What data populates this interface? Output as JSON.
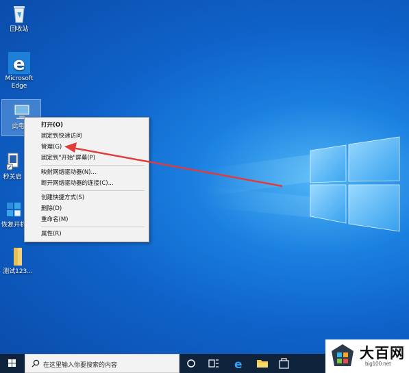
{
  "desktop": {
    "icons": [
      {
        "label": "回收站",
        "icon": "recycle-bin-icon"
      },
      {
        "label": "Microsoft Edge",
        "icon": "edge-icon"
      },
      {
        "label": "此电脑",
        "icon": "this-pc-icon"
      },
      {
        "label": "秒关启",
        "icon": "shortcut-icon"
      },
      {
        "label": "恢复开机",
        "icon": "restore-icon"
      },
      {
        "label": "测试123...",
        "icon": "folder-icon"
      }
    ]
  },
  "context_menu": {
    "items": [
      {
        "label": "打开(O)",
        "bold": true
      },
      {
        "label": "固定到快速访问"
      },
      {
        "label": "管理(G)"
      },
      {
        "label": "固定到\"开始\"屏幕(P)"
      },
      {
        "separator": true
      },
      {
        "label": "映射网络驱动器(N)..."
      },
      {
        "label": "断开网络驱动器的连接(C)..."
      },
      {
        "separator": true
      },
      {
        "label": "创建快捷方式(S)"
      },
      {
        "label": "删除(D)"
      },
      {
        "label": "重命名(M)"
      },
      {
        "separator": true
      },
      {
        "label": "属性(R)"
      }
    ]
  },
  "taskbar": {
    "search_placeholder": "在这里输入你要搜索的内容",
    "buttons": [
      "windows-start-icon",
      "cortana-icon",
      "task-view-icon",
      "edge-icon",
      "file-explorer-icon",
      "store-icon"
    ]
  },
  "watermark": {
    "title": "大百网",
    "url": "big100.net"
  },
  "colors": {
    "arrow": "#e03c3c",
    "taskbar": "#10233c",
    "menu_bg": "#f2f2f2"
  }
}
